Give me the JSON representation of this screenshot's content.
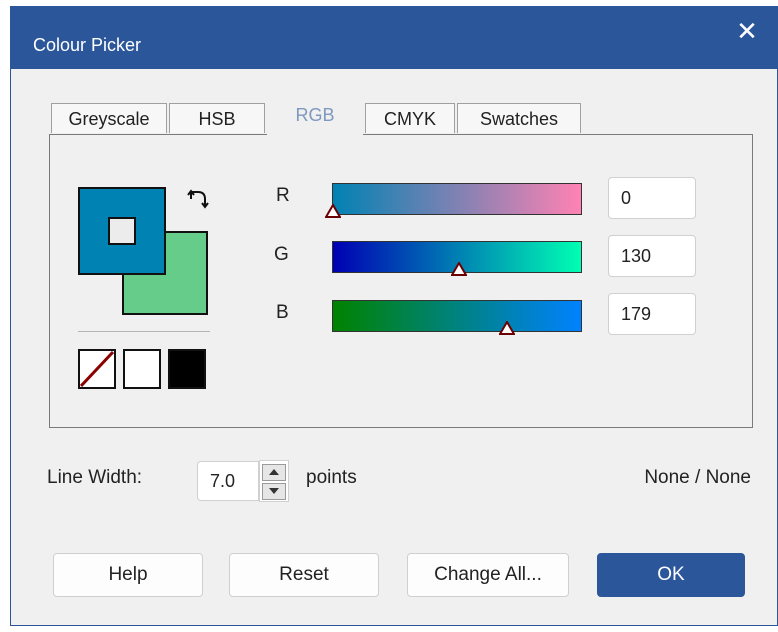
{
  "window": {
    "title": "Colour Picker",
    "close_glyph": "✕"
  },
  "tabs": [
    {
      "label": "Greyscale",
      "active": false
    },
    {
      "label": "HSB",
      "active": false
    },
    {
      "label": "RGB",
      "active": true
    },
    {
      "label": "CMYK",
      "active": false
    },
    {
      "label": "Swatches",
      "active": false
    }
  ],
  "colors": {
    "primary": "#0082b3",
    "secondary": "#66cc8a",
    "accent": "#2b579a"
  },
  "channels": {
    "r": {
      "label": "R",
      "value": "0",
      "level": 0.0
    },
    "g": {
      "label": "G",
      "value": "130",
      "level": 0.51
    },
    "b": {
      "label": "B",
      "value": "179",
      "level": 0.7
    }
  },
  "line_width": {
    "label": "Line Width:",
    "value": "7.0",
    "units": "points"
  },
  "status": "None / None",
  "buttons": {
    "help": "Help",
    "reset": "Reset",
    "change_all": "Change All...",
    "ok": "OK"
  },
  "icons": [
    "swap-colors-icon",
    "no-colour-icon",
    "white-icon",
    "black-icon",
    "spin-up-icon",
    "spin-down-icon",
    "close-icon"
  ]
}
